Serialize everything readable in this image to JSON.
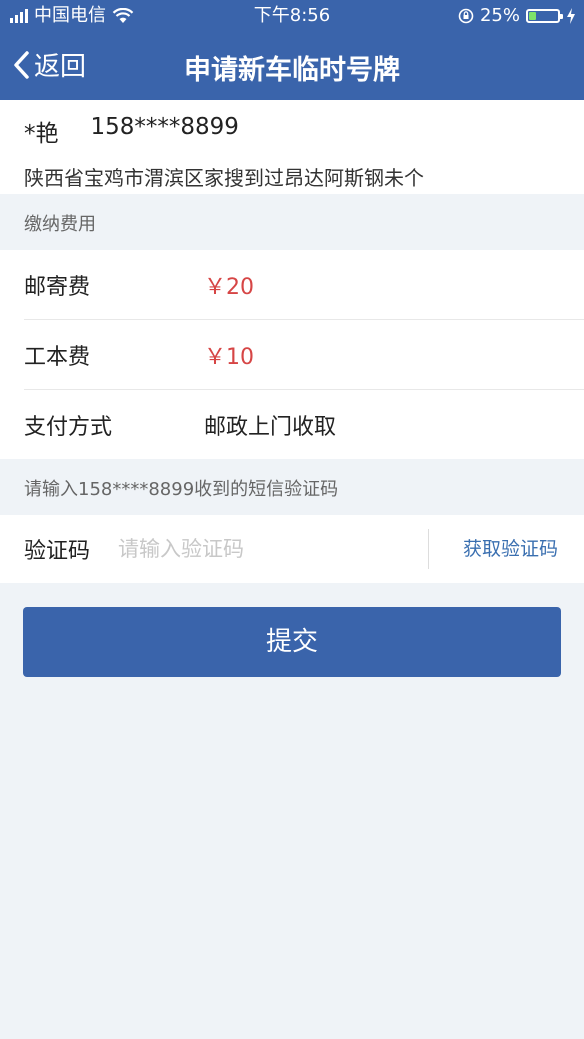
{
  "status_bar": {
    "carrier": "中国电信",
    "time": "下午8:56",
    "battery_percent": "25%",
    "battery_level": 0.25
  },
  "nav": {
    "back_label": "返回",
    "title": "申请新车临时号牌"
  },
  "recipient": {
    "name": "*艳",
    "phone": "158****8899",
    "address": "陕西省宝鸡市渭滨区家搜到过昂达阿斯钢未个"
  },
  "fees": {
    "section_label": "缴纳费用",
    "rows": [
      {
        "label": "邮寄费",
        "value": "￥20"
      },
      {
        "label": "工本费",
        "value": "￥10"
      },
      {
        "label": "支付方式",
        "value": "邮政上门收取"
      }
    ]
  },
  "verify": {
    "hint": "请输入158****8899收到的短信验证码",
    "label": "验证码",
    "placeholder": "请输入验证码",
    "get_code_label": "获取验证码"
  },
  "submit_label": "提交",
  "colors": {
    "brand": "#3a64ab",
    "price": "#d64545",
    "link": "#3a6fb0"
  }
}
